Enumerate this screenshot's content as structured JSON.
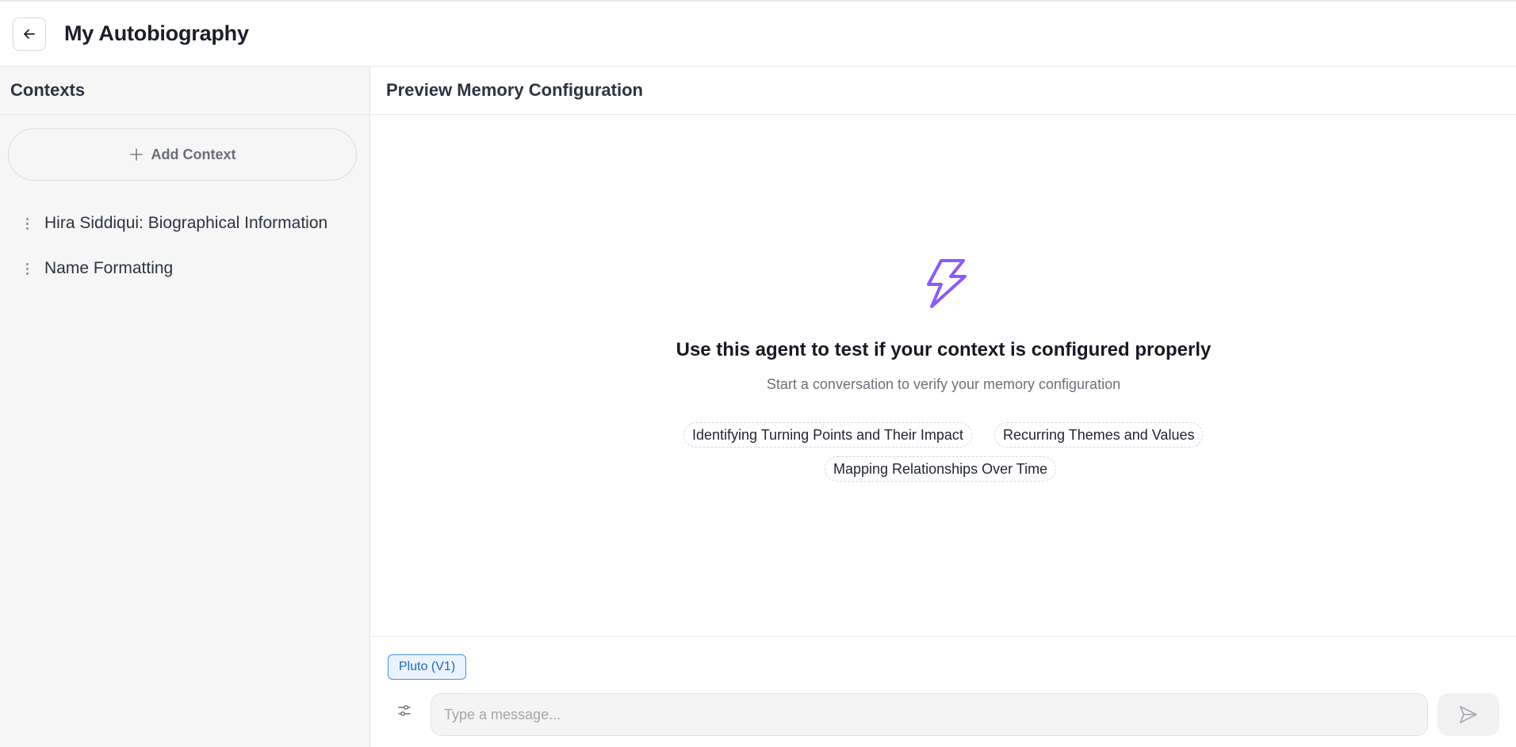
{
  "header": {
    "title": "My Autobiography"
  },
  "sidebar": {
    "title": "Contexts",
    "add_label": "Add Context",
    "items": [
      {
        "label": "Hira Siddiqui: Biographical Information"
      },
      {
        "label": "Name Formatting"
      }
    ]
  },
  "main": {
    "title": "Preview Memory Configuration",
    "empty_title": "Use this agent to test if your context is configured properly",
    "empty_subtitle": "Start a conversation to verify your memory configuration",
    "suggestions": [
      "Identifying Turning Points and Their Impact",
      "Recurring Themes and Values",
      "Mapping Relationships Over Time"
    ]
  },
  "composer": {
    "model": "Pluto (V1)",
    "placeholder": "Type a message..."
  },
  "colors": {
    "accent": "#8b5cf6",
    "badge_border": "#4a90e2",
    "badge_text": "#2467b6"
  },
  "icons": [
    "arrow-left-icon",
    "plus-icon",
    "kebab-menu-icon",
    "lightning-bolt-icon",
    "sliders-icon",
    "send-icon"
  ]
}
